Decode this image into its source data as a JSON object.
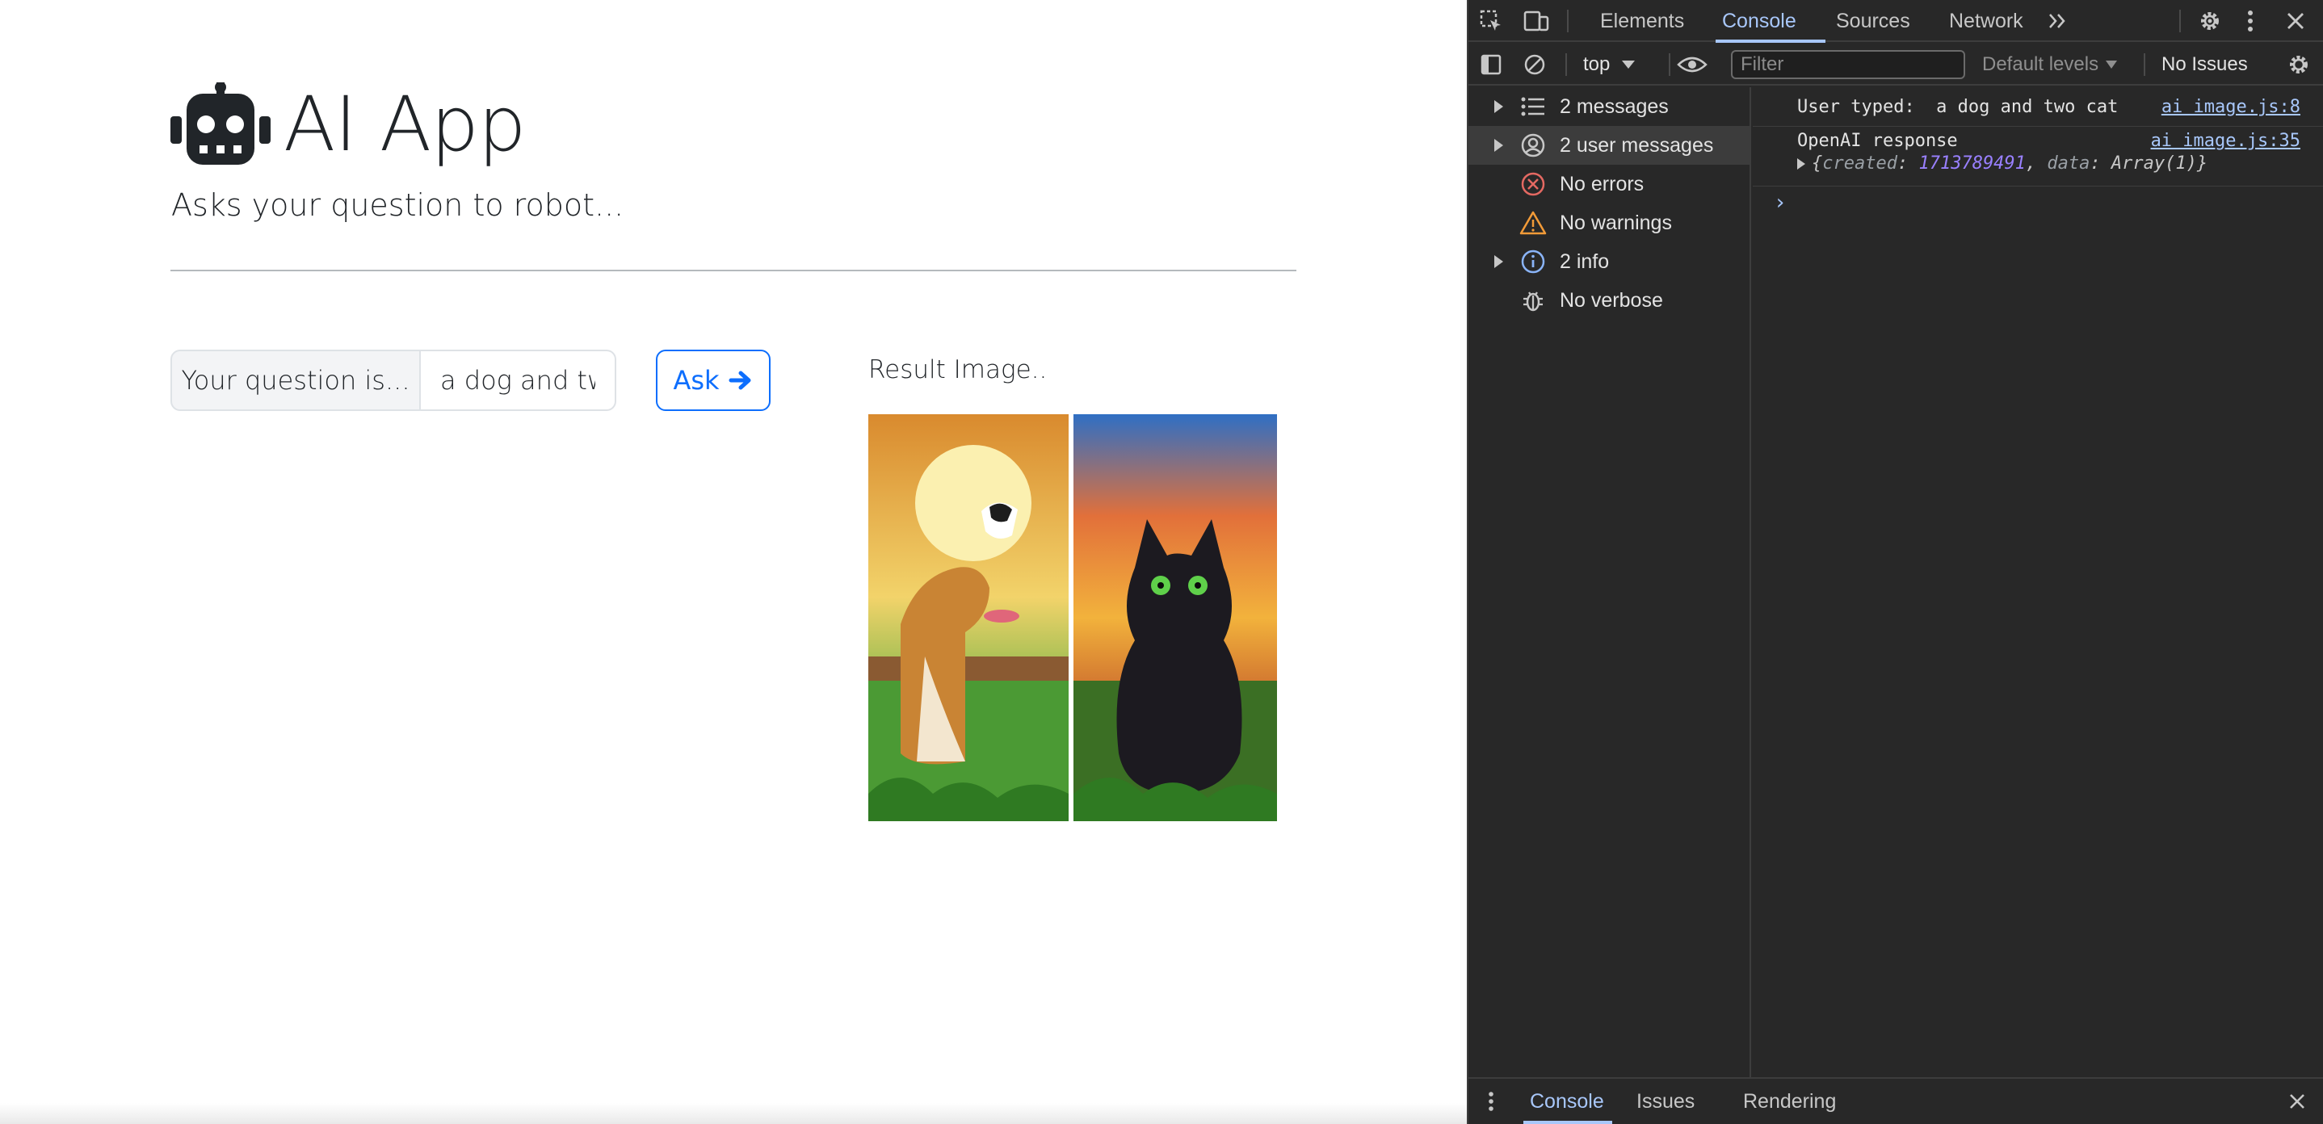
{
  "app": {
    "title": "AI App",
    "subtitle": "Asks your question to robot...",
    "input_label": "Your question is...",
    "input_value": "a dog and two cat",
    "ask_label": "Ask",
    "result_label": "Result Image.."
  },
  "devtools": {
    "tabs": [
      "Elements",
      "Console",
      "Sources",
      "Network"
    ],
    "active_tab": "Console",
    "context": "top",
    "filter_placeholder": "Filter",
    "levels": "Default levels",
    "issues": "No Issues",
    "sidebar": [
      {
        "label": "2 messages",
        "icon": "list-icon",
        "expandable": true
      },
      {
        "label": "2 user messages",
        "icon": "user-icon",
        "expandable": true,
        "selected": true
      },
      {
        "label": "No errors",
        "icon": "error-icon",
        "expandable": false
      },
      {
        "label": "No warnings",
        "icon": "warning-icon",
        "expandable": false
      },
      {
        "label": "2 info",
        "icon": "info-icon",
        "expandable": true
      },
      {
        "label": "No verbose",
        "icon": "bug-icon",
        "expandable": false
      }
    ],
    "logs": [
      {
        "text": "User typed:  a dog and two cat",
        "source": "ai image.js:8"
      },
      {
        "text": "OpenAI response",
        "source": "ai image.js:35"
      }
    ],
    "response_object": {
      "created_key": "created",
      "created_value": "1713789491",
      "data_key": "data",
      "data_value": "Array(1)"
    },
    "drawer_tabs": [
      "Console",
      "Issues",
      "Rendering"
    ],
    "colors": {
      "accent": "#a8c7fa",
      "background": "#282828",
      "error": "#e46962",
      "warning": "#f29b38",
      "info": "#8ab4f8"
    }
  },
  "colors": {
    "primary": "#0d6efd",
    "text": "#212529"
  }
}
